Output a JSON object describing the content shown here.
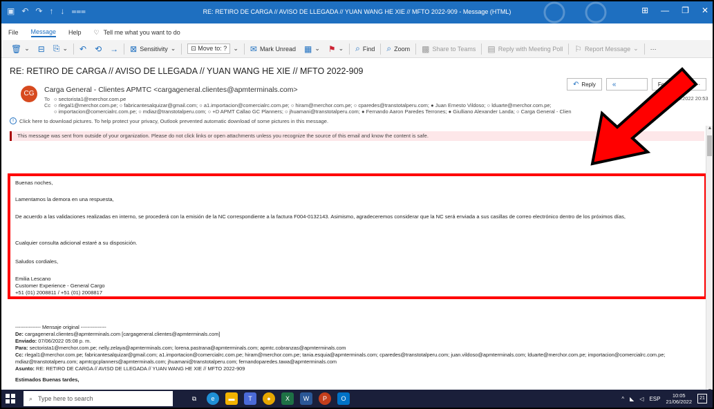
{
  "window": {
    "title": "RE: RETIRO DE CARGA // AVISO DE LLEGADA // YUAN WANG HE XIE // MFTO 2022-909  -  Message (HTML)"
  },
  "menu": {
    "file": "File",
    "message": "Message",
    "help": "Help",
    "tell_me": "Tell me what you want to do"
  },
  "ribbon": {
    "sensitivity": "Sensitivity",
    "move_to": "Move to: ?",
    "mark_unread": "Mark Unread",
    "find": "Find",
    "zoom": "Zoom",
    "share_teams": "Share to Teams",
    "reply_meeting": "Reply with Meeting Poll",
    "report_message": "Report Message",
    "more": "···"
  },
  "email": {
    "subject": "RE: RETIRO DE CARGA // AVISO DE LLEGADA // YUAN WANG HE XIE // MFTO 2022-909",
    "avatar_initials": "CG",
    "sender": "Carga General - Clientes APMTC <cargageneral.clientes@apmterminals.com>",
    "to_label": "To",
    "to": "sectorista1@merchor.com.pe",
    "cc_label": "Cc",
    "cc_line1": "rlegal1@merchor.com.pe;  ○ fabricantesalquizar@gmail.com;  ○ a1.importacion@comercialrc.com.pe;  ○ hiram@merchor.com.pe;  ○ cparedes@transtotalperu.com;  ● Juan Ernesto Vildoso;  ○ lduarte@merchor.com.pe;",
    "cc_line2": "importacion@comercialrc.com.pe;  ○ mdiaz@transtotalperu.com;  ○ +D APMT Callao GC Planners;  ○ jhuamani@transtotalperu.com;  ● Fernando Aaron Paredes Terrones;  ● Giulliano Alexander Landa;  ○ Carga General - Clien",
    "download_notice": "Click here to download pictures. To help protect your privacy, Outlook prevented automatic download of some pictures in this message.",
    "reply": "Reply",
    "forward": "Forward",
    "more": "···",
    "date": "nes 20/06/2022 20:53",
    "warning": "This message was sent from outside of your organization. Please do not click links or open attachments unless you recognize the source of this email and know the content is safe."
  },
  "body": {
    "greeting": "Buenas noches,",
    "line1": "Lamentamos la demora en una respuesta,",
    "line2": "De acuerdo a las validaciones realizadas en interno, se procederá con la emisión de la NC correspondiente a la factura F004-0132143. Asimismo, agradeceremos considerar que la NC será enviada a sus casillas de correo electrónico dentro de los próximos días,",
    "line3": "Cualquier consulta adicional estaré a su disposición.",
    "closing": "Saludos cordiales,",
    "sig_name": "Emilia Lescano",
    "sig_title": "Customer Experience - General Cargo",
    "sig_phone": "+51 (01) 2008811 / +51 (01) 2008817"
  },
  "original": {
    "header": "--------------- Mensaje original ---------------",
    "de_label": "De:",
    "de": "cargageneral.clientes@apmterminals.com [cargageneral.clientes@apmterminals.com]",
    "enviado_label": "Enviado:",
    "enviado": "07/06/2022 05:08 p. m.",
    "para_label": "Para:",
    "para": "sectorista1@merchor.com.pe; nelly.zelaya@apmterminals.com; lorena.pastrana@apmterminals.com; apmtc.cobranzas@apmterminals.com",
    "cc_label": "Cc:",
    "cc": "rlegal1@merchor.com.pe; fabricantesalquizar@gmail.com; a1.importacion@comercialrc.com.pe; hiram@merchor.com.pe; tania.esquia@apmterminals.com; cparedes@transtotalperu.com; juan.vildoso@apmterminals.com; lduarte@merchor.com.pe; importacion@comercialrc.com.pe; mdiaz@transtotalperu.com; apmtcgcplanners@apmterminals.com; jhuamani@transtotalperu.com; fernandoparedes.tawa@apmterminals.com",
    "asunto_label": "Asunto:",
    "asunto": "RE: RETIRO DE CARGA // AVISO DE LLEGADA // YUAN WANG HE XIE // MFTO 2022-909",
    "closing": "Estimados Buenas tardes,"
  },
  "taskbar": {
    "search_placeholder": "Type here to search",
    "lang": "ESP",
    "time": "10:05",
    "date": "21/06/2022",
    "notif_count": "21"
  },
  "colors": {
    "titlebar": "#1e6fc0",
    "annotation_red": "#ff0000",
    "taskbar": "#1a1f3a"
  }
}
